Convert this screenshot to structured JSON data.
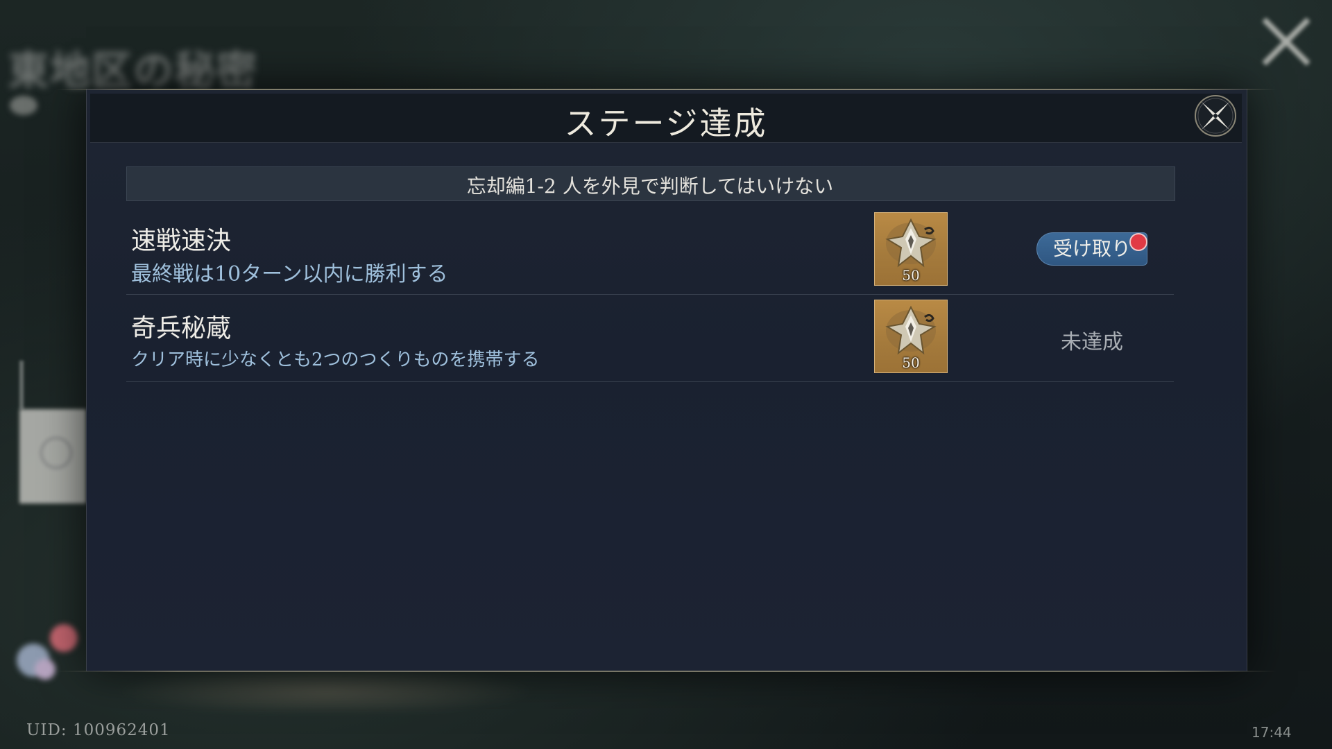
{
  "background": {
    "title": "東地区の秘密"
  },
  "modal": {
    "title": "ステージ達成",
    "subtitle": "忘却編1-2 人を外見で判断してはいけない",
    "achievements": [
      {
        "name": "速戦速決",
        "description": "最終戦は10ターン以内に勝利する",
        "reward_count": "50",
        "reward_icon": "crystal-emblem-icon",
        "status": "claimable",
        "action_label": "受け取り",
        "has_notification": true
      },
      {
        "name": "奇兵秘蔵",
        "description": "クリア時に少なくとも2つのつくりものを携帯する",
        "reward_count": "50",
        "reward_icon": "crystal-emblem-icon",
        "status": "locked",
        "status_label": "未達成"
      }
    ]
  },
  "footer": {
    "uid": "UID: 100962401",
    "time": "17:44"
  },
  "colors": {
    "modal_bg": "#1c2333",
    "accent_blue": "#3d6a98",
    "desc_text": "#9fc0dc",
    "badge_red": "#e03a45",
    "reward_gold": "#b98a45"
  }
}
